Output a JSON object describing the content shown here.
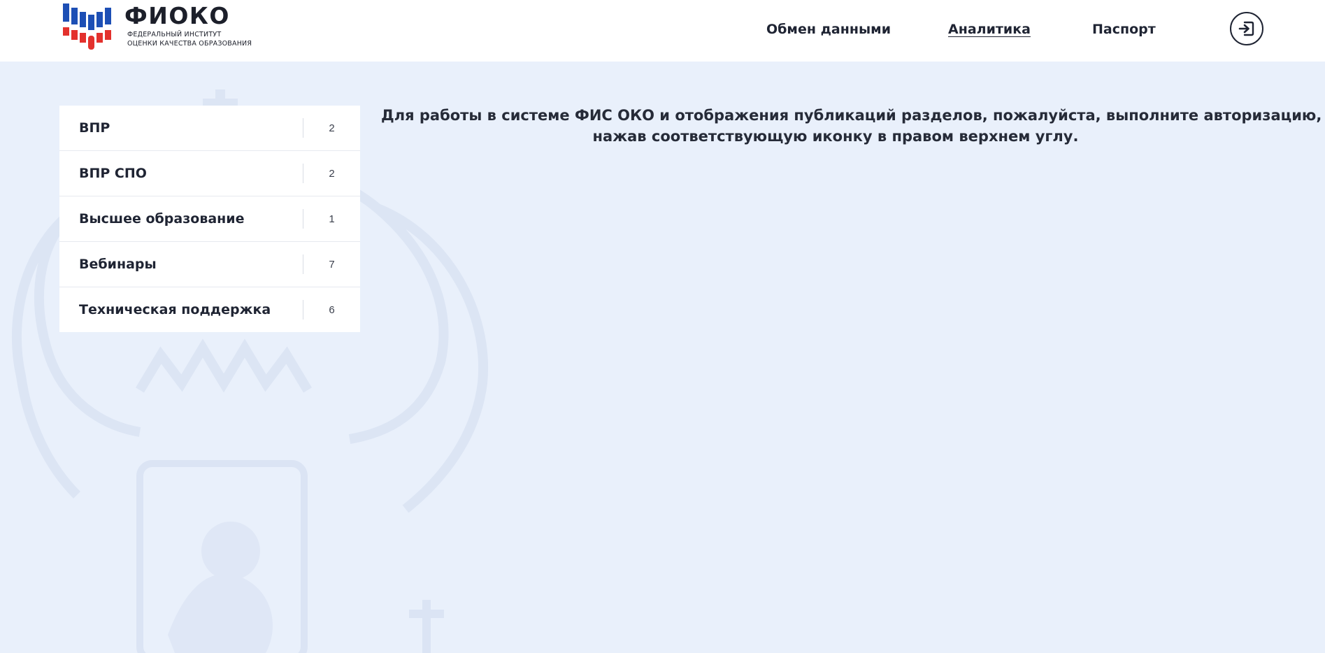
{
  "header": {
    "logo": {
      "title": "ФИОКО",
      "subtitle_line1": "ФЕДЕРАЛЬНЫЙ ИНСТИТУТ",
      "subtitle_line2": "ОЦЕНКИ КАЧЕСТВА ОБРАЗОВАНИЯ",
      "colors": {
        "blue": "#1d4fb5",
        "red": "#e3312d",
        "white": "#ffffff"
      }
    },
    "nav": [
      {
        "label": "Обмен данными",
        "active": false
      },
      {
        "label": "Аналитика",
        "active": true
      },
      {
        "label": "Паспорт",
        "active": false
      }
    ],
    "login_icon": "login-icon"
  },
  "sidebar": {
    "items": [
      {
        "label": "ВПР",
        "count": "2"
      },
      {
        "label": "ВПР СПО",
        "count": "2"
      },
      {
        "label": "Высшее образование",
        "count": "1"
      },
      {
        "label": "Вебинары",
        "count": "7"
      },
      {
        "label": "Техническая поддержка",
        "count": "6"
      }
    ]
  },
  "main": {
    "notice_line1": "Для работы в системе ФИС ОКО и отображения публикаций разделов, пожалуйста, выполните авторизацию,",
    "notice_line2": "нажав соответствующую иконку в правом верхнем углу."
  },
  "background": {
    "color": "#e9f0fb",
    "emblem_icon": "coat-of-arms-watermark"
  }
}
